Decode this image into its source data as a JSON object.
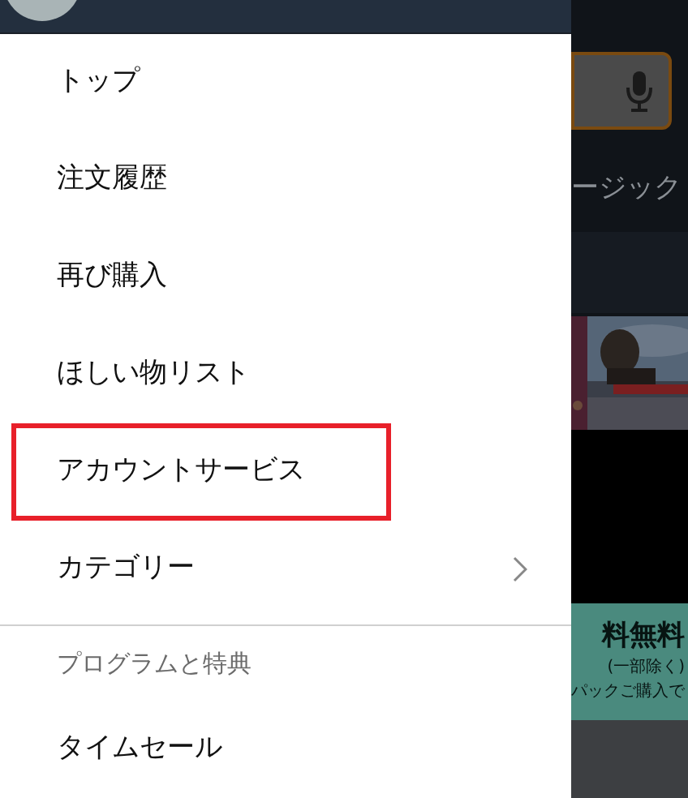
{
  "menu": {
    "items": [
      {
        "label": "トップ",
        "highlighted": false,
        "submenu": false
      },
      {
        "label": "注文履歴",
        "highlighted": false,
        "submenu": false
      },
      {
        "label": "再び購入",
        "highlighted": false,
        "submenu": false
      },
      {
        "label": "ほしい物リスト",
        "highlighted": false,
        "submenu": false
      },
      {
        "label": "アカウントサービス",
        "highlighted": true,
        "submenu": false
      },
      {
        "label": "カテゴリー",
        "highlighted": false,
        "submenu": true
      }
    ],
    "sections": [
      {
        "heading": "プログラムと特典",
        "items": [
          {
            "label": "タイムセール",
            "highlighted": false,
            "submenu": false
          }
        ]
      }
    ]
  },
  "background": {
    "nav_text": "ージック",
    "banner": {
      "headline": "料無料",
      "note": "(一部除く)",
      "footer": "パックご購入で"
    }
  }
}
